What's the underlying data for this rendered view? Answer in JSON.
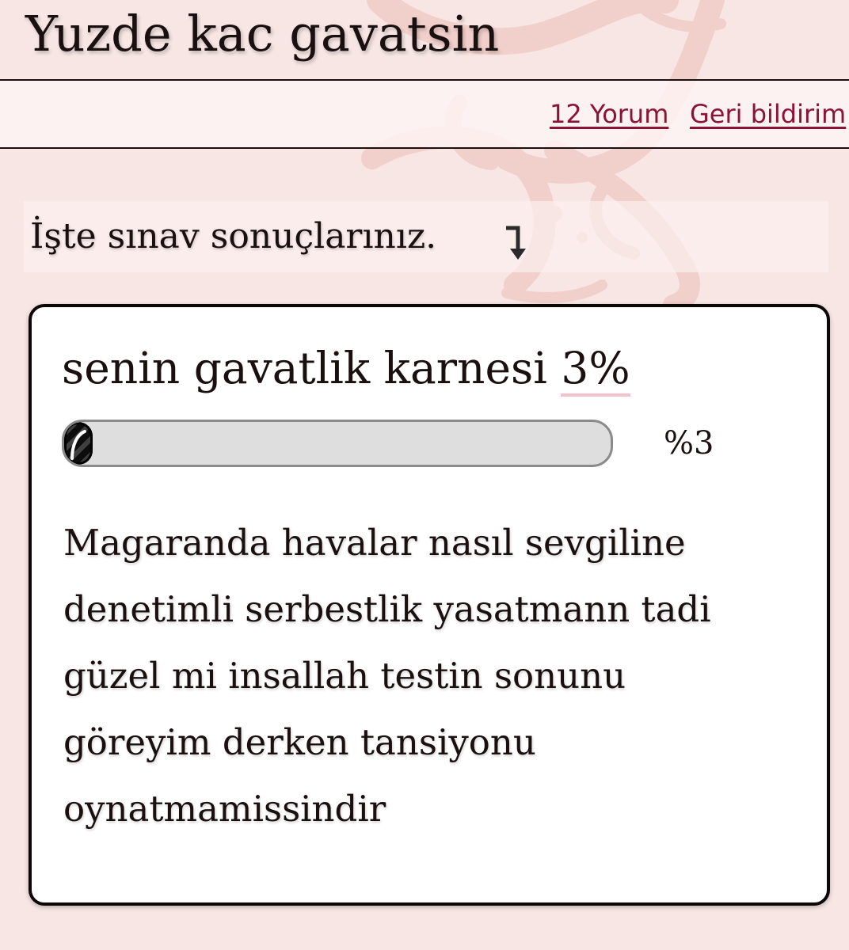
{
  "header": {
    "title": "Yuzde kac gavatsin"
  },
  "links": {
    "comments": "12 Yorum",
    "feedback": "Geri bildirim"
  },
  "intro": {
    "text": "İşte sınav sonuçlarınız."
  },
  "result": {
    "title_prefix": "senin gavatlik karnesi",
    "score": "3%",
    "progress_label": "%3",
    "progress_fraction": 0.03,
    "description": "Magaranda havalar nasıl sevgiline denetimli serbestlik yasatmann tadi güzel mi insallah testin sonunu göreyim derken tansiyonu oynatmamissindir"
  },
  "colors": {
    "page_background": "#f7e6e4",
    "link": "#8c1236",
    "score_underline": "#f2c3cc",
    "progress_track": "#dedede"
  },
  "icons": {
    "intro_arrow": "arrow-down-right-icon",
    "background": "decorative-swirl-pattern"
  }
}
